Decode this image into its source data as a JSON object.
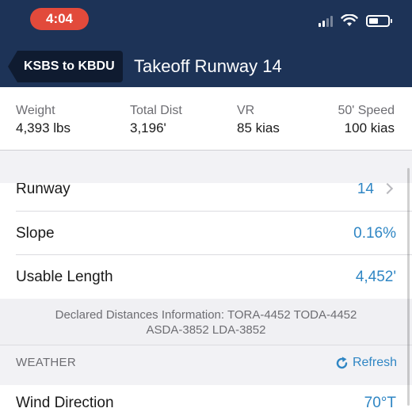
{
  "status_bar": {
    "time": "4:04"
  },
  "nav": {
    "back_label": "KSBS to KBDU",
    "title": "Takeoff Runway 14"
  },
  "summary": [
    {
      "label": "Weight",
      "value": "4,393 lbs"
    },
    {
      "label": "Total Dist",
      "value": "3,196'"
    },
    {
      "label": "VR",
      "value": "85 kias"
    },
    {
      "label": "50' Speed",
      "value": "100 kias"
    }
  ],
  "rows": {
    "runway": {
      "label": "Runway",
      "value": "14"
    },
    "slope": {
      "label": "Slope",
      "value": "0.16%"
    },
    "usable_length": {
      "label": "Usable Length",
      "value": "4,452'"
    }
  },
  "declared_distances": {
    "line1": "Declared Distances Information:  TORA-4452  TODA-4452",
    "line2": "ASDA-3852  LDA-3852"
  },
  "weather": {
    "section_title": "WEATHER",
    "refresh_label": "Refresh",
    "wind_direction": {
      "label": "Wind Direction",
      "value": "70°T"
    }
  },
  "colors": {
    "nav_background": "#1d3357",
    "accent": "#2f86c4",
    "time_pill": "#e24a3b"
  }
}
